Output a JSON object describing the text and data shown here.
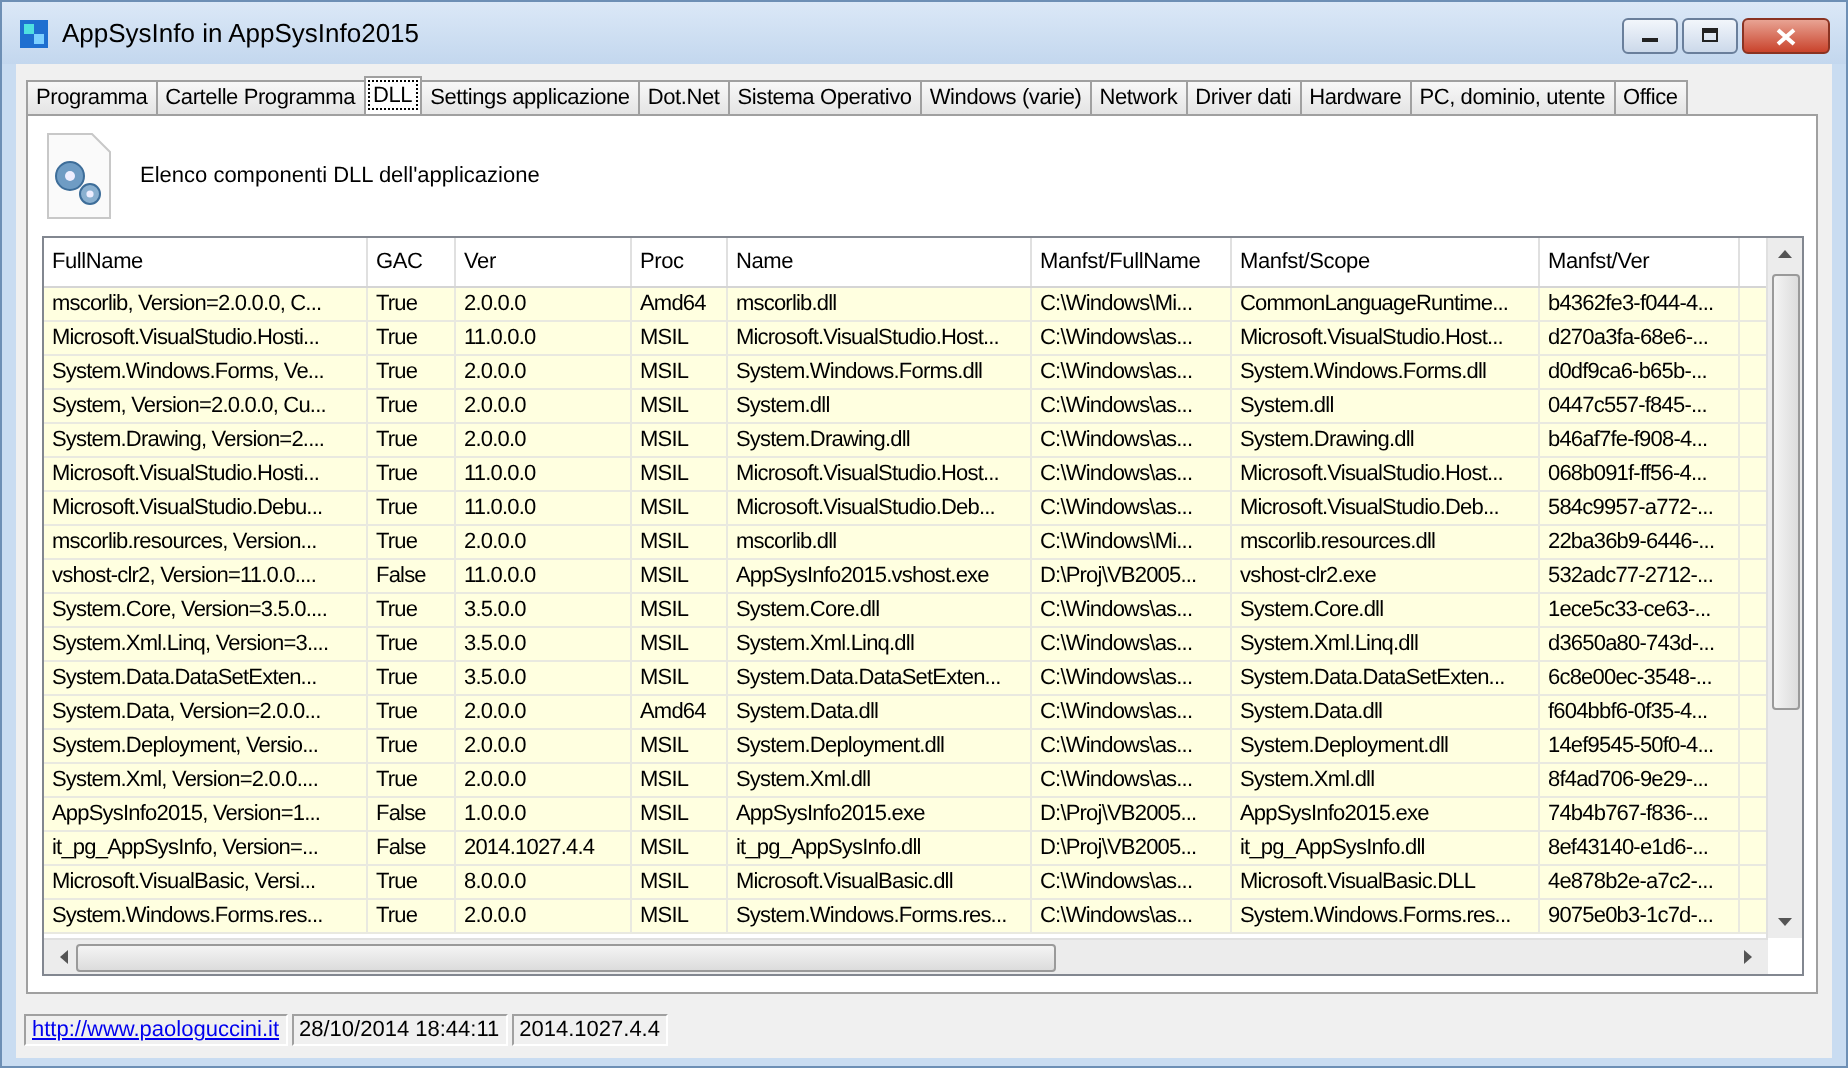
{
  "window": {
    "title": "AppSysInfo in AppSysInfo2015"
  },
  "tabs": [
    {
      "label": "Programma",
      "selected": false
    },
    {
      "label": "Cartelle Programma",
      "selected": false
    },
    {
      "label": "DLL",
      "selected": true
    },
    {
      "label": "Settings applicazione",
      "selected": false
    },
    {
      "label": "Dot.Net",
      "selected": false
    },
    {
      "label": "Sistema Operativo",
      "selected": false
    },
    {
      "label": "Windows (varie)",
      "selected": false
    },
    {
      "label": "Network",
      "selected": false
    },
    {
      "label": "Driver dati",
      "selected": false
    },
    {
      "label": "Hardware",
      "selected": false
    },
    {
      "label": "PC, dominio, utente",
      "selected": false
    },
    {
      "label": "Office",
      "selected": false
    }
  ],
  "header": {
    "text": "Elenco componenti DLL dell'applicazione"
  },
  "table": {
    "columns": [
      "FullName",
      "GAC",
      "Ver",
      "Proc",
      "Name",
      "Manfst/FullName",
      "Manfst/Scope",
      "Manfst/Ver"
    ],
    "rows": [
      [
        "mscorlib, Version=2.0.0.0, C...",
        "True",
        "2.0.0.0",
        "Amd64",
        "mscorlib.dll",
        "C:\\Windows\\Mi...",
        "CommonLanguageRuntime...",
        "b4362fe3-f044-4..."
      ],
      [
        "Microsoft.VisualStudio.Hosti...",
        "True",
        "11.0.0.0",
        "MSIL",
        "Microsoft.VisualStudio.Host...",
        "C:\\Windows\\as...",
        "Microsoft.VisualStudio.Host...",
        "d270a3fa-68e6-..."
      ],
      [
        "System.Windows.Forms, Ve...",
        "True",
        "2.0.0.0",
        "MSIL",
        "System.Windows.Forms.dll",
        "C:\\Windows\\as...",
        "System.Windows.Forms.dll",
        "d0df9ca6-b65b-..."
      ],
      [
        "System, Version=2.0.0.0, Cu...",
        "True",
        "2.0.0.0",
        "MSIL",
        "System.dll",
        "C:\\Windows\\as...",
        "System.dll",
        "0447c557-f845-..."
      ],
      [
        "System.Drawing, Version=2....",
        "True",
        "2.0.0.0",
        "MSIL",
        "System.Drawing.dll",
        "C:\\Windows\\as...",
        "System.Drawing.dll",
        "b46af7fe-f908-4..."
      ],
      [
        "Microsoft.VisualStudio.Hosti...",
        "True",
        "11.0.0.0",
        "MSIL",
        "Microsoft.VisualStudio.Host...",
        "C:\\Windows\\as...",
        "Microsoft.VisualStudio.Host...",
        "068b091f-ff56-4..."
      ],
      [
        "Microsoft.VisualStudio.Debu...",
        "True",
        "11.0.0.0",
        "MSIL",
        "Microsoft.VisualStudio.Deb...",
        "C:\\Windows\\as...",
        "Microsoft.VisualStudio.Deb...",
        "584c9957-a772-..."
      ],
      [
        "mscorlib.resources, Version...",
        "True",
        "2.0.0.0",
        "MSIL",
        "mscorlib.dll",
        "C:\\Windows\\Mi...",
        "mscorlib.resources.dll",
        "22ba36b9-6446-..."
      ],
      [
        "vshost-clr2, Version=11.0.0....",
        "False",
        "11.0.0.0",
        "MSIL",
        "AppSysInfo2015.vshost.exe",
        "D:\\Proj\\VB2005...",
        "vshost-clr2.exe",
        "532adc77-2712-..."
      ],
      [
        "System.Core, Version=3.5.0....",
        "True",
        "3.5.0.0",
        "MSIL",
        "System.Core.dll",
        "C:\\Windows\\as...",
        "System.Core.dll",
        "1ece5c33-ce63-..."
      ],
      [
        "System.Xml.Linq, Version=3....",
        "True",
        "3.5.0.0",
        "MSIL",
        "System.Xml.Linq.dll",
        "C:\\Windows\\as...",
        "System.Xml.Linq.dll",
        "d3650a80-743d-..."
      ],
      [
        "System.Data.DataSetExten...",
        "True",
        "3.5.0.0",
        "MSIL",
        "System.Data.DataSetExten...",
        "C:\\Windows\\as...",
        "System.Data.DataSetExten...",
        "6c8e00ec-3548-..."
      ],
      [
        "System.Data, Version=2.0.0...",
        "True",
        "2.0.0.0",
        "Amd64",
        "System.Data.dll",
        "C:\\Windows\\as...",
        "System.Data.dll",
        "f604bbf6-0f35-4..."
      ],
      [
        "System.Deployment, Versio...",
        "True",
        "2.0.0.0",
        "MSIL",
        "System.Deployment.dll",
        "C:\\Windows\\as...",
        "System.Deployment.dll",
        "14ef9545-50f0-4..."
      ],
      [
        "System.Xml, Version=2.0.0....",
        "True",
        "2.0.0.0",
        "MSIL",
        "System.Xml.dll",
        "C:\\Windows\\as...",
        "System.Xml.dll",
        "8f4ad706-9e29-..."
      ],
      [
        "AppSysInfo2015, Version=1...",
        "False",
        "1.0.0.0",
        "MSIL",
        "AppSysInfo2015.exe",
        "D:\\Proj\\VB2005...",
        "AppSysInfo2015.exe",
        "74b4b767-f836-..."
      ],
      [
        "it_pg_AppSysInfo, Version=...",
        "False",
        "2014.1027.4.4",
        "MSIL",
        "it_pg_AppSysInfo.dll",
        "D:\\Proj\\VB2005...",
        "it_pg_AppSysInfo.dll",
        "8ef43140-e1d6-..."
      ],
      [
        "Microsoft.VisualBasic, Versi...",
        "True",
        "8.0.0.0",
        "MSIL",
        "Microsoft.VisualBasic.dll",
        "C:\\Windows\\as...",
        "Microsoft.VisualBasic.DLL",
        "4e878b2e-a7c2-..."
      ],
      [
        "System.Windows.Forms.res...",
        "True",
        "2.0.0.0",
        "MSIL",
        "System.Windows.Forms.res...",
        "C:\\Windows\\as...",
        "System.Windows.Forms.res...",
        "9075e0b3-1c7d-..."
      ]
    ]
  },
  "status_bar": {
    "link": "http://www.paologuccini.it",
    "datetime": "28/10/2014 18:44:11",
    "version": "2014.1027.4.4"
  }
}
